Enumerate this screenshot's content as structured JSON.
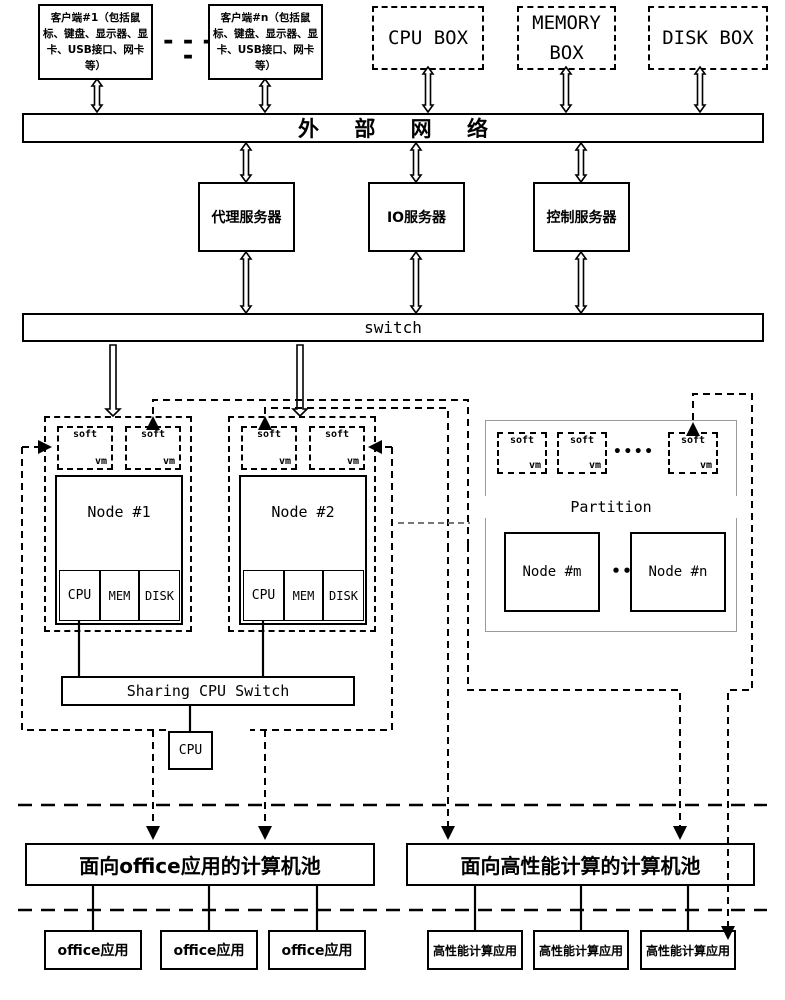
{
  "diagram": {
    "title": "Computing pool architecture diagram",
    "clients": [
      {
        "name": "client-1",
        "text": "客户端#1（包括鼠标、键盘、显示器、显卡、USB接口、网卡等）"
      },
      {
        "name": "client-n",
        "text": "客户端#n（包括鼠标、键盘、显示器、显卡、USB接口、网卡等）"
      }
    ],
    "resource_boxes": [
      {
        "name": "cpu-box",
        "label": "CPU BOX"
      },
      {
        "name": "memory-box",
        "label": "MEMORY BOX"
      },
      {
        "name": "disk-box",
        "label": "DISK BOX"
      }
    ],
    "external_network": {
      "label": "外 部 网 络"
    },
    "servers": [
      {
        "name": "proxy-server",
        "label": "代理服务器"
      },
      {
        "name": "io-server",
        "label": "IO服务器"
      },
      {
        "name": "control-server",
        "label": "控制服务器"
      }
    ],
    "switch": {
      "label": "switch"
    },
    "nodes": [
      {
        "name": "node-1",
        "label": "Node #1",
        "vms": [
          {
            "soft": "soft",
            "vm": "vm"
          },
          {
            "soft": "soft",
            "vm": "vm"
          }
        ],
        "resources": [
          "CPU",
          "MEM",
          "DISK"
        ]
      },
      {
        "name": "node-2",
        "label": "Node #2",
        "vms": [
          {
            "soft": "soft",
            "vm": "vm"
          },
          {
            "soft": "soft",
            "vm": "vm"
          }
        ],
        "resources": [
          "CPU",
          "MEM",
          "DISK"
        ]
      }
    ],
    "partition": {
      "label": "Partition",
      "vms": [
        {
          "soft": "soft",
          "vm": "vm"
        },
        {
          "soft": "soft",
          "vm": "vm"
        },
        {
          "soft": "soft",
          "vm": "vm"
        }
      ],
      "vm_ellipsis": "••••",
      "nodes": [
        {
          "name": "node-m",
          "label": "Node #m"
        },
        {
          "name": "node-n",
          "label": "Node #n"
        }
      ],
      "node_ellipsis": "•••"
    },
    "sharing_switch": {
      "label": "Sharing CPU Switch"
    },
    "shared_cpu": {
      "label": "CPU"
    },
    "pools": [
      {
        "name": "office-pool",
        "label": "面向office应用的计算机池",
        "apps": [
          {
            "label": "office应用"
          },
          {
            "label": "office应用"
          },
          {
            "label": "office应用"
          }
        ]
      },
      {
        "name": "hpc-pool",
        "label": "面向高性能计算的计算机池",
        "apps": [
          {
            "label": "高性能计算应用"
          },
          {
            "label": "高性能计算应用"
          },
          {
            "label": "高性能计算应用"
          }
        ]
      }
    ],
    "client_ellipsis": "▬ ▬ ▬ ▬"
  }
}
